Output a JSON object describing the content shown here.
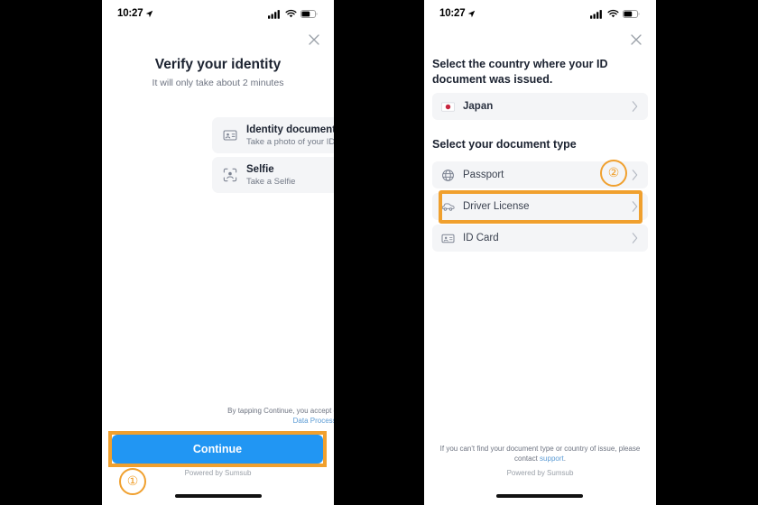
{
  "screens": {
    "left": {
      "status": {
        "time": "10:27",
        "location_icon": "location-arrow-icon",
        "signal_icon": "cellular-signal-icon",
        "wifi_icon": "wifi-icon",
        "battery_icon": "battery-icon"
      },
      "close_icon": "close-icon",
      "title": "Verify your identity",
      "subtitle": "It will only take about 2 minutes",
      "options": [
        {
          "icon": "id-document-icon",
          "title": "Identity document",
          "subtitle": "Take a photo of your ID"
        },
        {
          "icon": "face-scan-icon",
          "title": "Selfie",
          "subtitle": "Take a Selfie"
        }
      ],
      "consent_prefix": "By tapping Continue, you accept our ",
      "consent_link": "Consent to Personal Data Processing",
      "continue_label": "Continue",
      "powered_by": "Powered by Sumsub"
    },
    "right": {
      "status": {
        "time": "10:27",
        "location_icon": "location-arrow-icon",
        "signal_icon": "cellular-signal-icon",
        "wifi_icon": "wifi-icon",
        "battery_icon": "battery-icon"
      },
      "close_icon": "close-icon",
      "country_heading": "Select the country where your ID document was issued.",
      "country": {
        "icon": "japan-flag-icon",
        "label": "Japan",
        "chevron": "chevron-right-icon"
      },
      "doctype_heading": "Select your document type",
      "doc_types": [
        {
          "icon": "globe-icon",
          "label": "Passport",
          "chevron": "chevron-right-icon"
        },
        {
          "icon": "car-icon",
          "label": "Driver License",
          "chevron": "chevron-right-icon"
        },
        {
          "icon": "id-card-icon",
          "label": "ID Card",
          "chevron": "chevron-right-icon"
        }
      ],
      "footnote_prefix": "If you can't find your document type or country of issue, please contact ",
      "footnote_link": "support",
      "footnote_suffix": ".",
      "powered_by": "Powered by Sumsub"
    }
  },
  "annotations": {
    "step_one": "①",
    "step_two": "②",
    "highlight_color": "#F0A02E",
    "accent_color": "#2196F3",
    "link_color": "#5B9BD5"
  }
}
